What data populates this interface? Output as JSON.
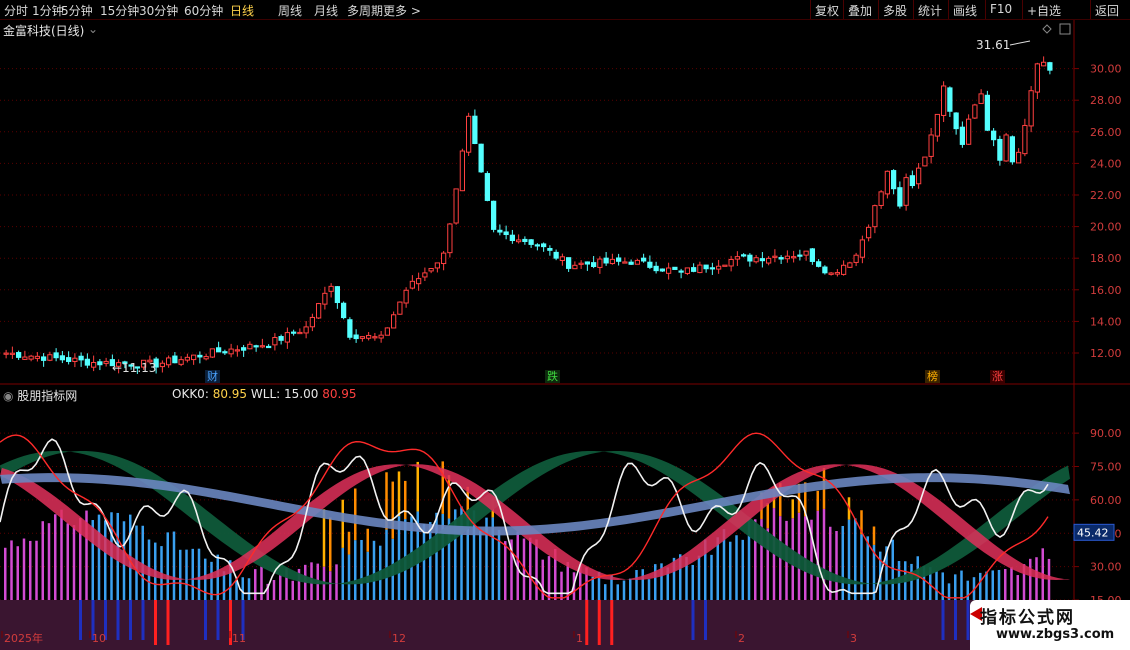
{
  "toolbar": {
    "left": [
      "分时",
      "1分钟",
      "5分钟",
      "15分钟",
      "30分钟",
      "60分钟",
      "日线",
      "周线",
      "月线",
      "多周期",
      "更多 >"
    ],
    "active": "日线",
    "right": [
      "复权",
      "叠加",
      "多股",
      "统计",
      "画线",
      "F10",
      "+自选",
      "返回"
    ]
  },
  "stock": {
    "title": "金富科技(日线)",
    "high_label": "31.61",
    "low_label": "11.13",
    "y_ticks": [
      "30.00",
      "28.00",
      "26.00",
      "24.00",
      "22.00",
      "20.00",
      "18.00",
      "16.00",
      "14.00",
      "12.00"
    ]
  },
  "markers": [
    {
      "text": "财",
      "color": "#4aa3ff",
      "bg": "#0a1f3a"
    },
    {
      "text": "跌",
      "color": "#3fdc3f",
      "bg": "#0d2a0d"
    },
    {
      "text": "榜",
      "color": "#ffb000",
      "bg": "#3a2400"
    },
    {
      "text": "涨",
      "color": "#ff4040",
      "bg": "#3a0000"
    }
  ],
  "indicator": {
    "name": "股朋指标网",
    "okk_label": "OKK0:",
    "okk_value": "80.95",
    "wll_label": "WLL:",
    "wll_value": "15.00",
    "extra_value": "80.95",
    "y_ticks": [
      "90.00",
      "75.00",
      "60.00",
      "45.00",
      "30.00",
      "15.00"
    ],
    "current_value": "45.42"
  },
  "time_axis": [
    "2025年",
    "10",
    "11",
    "12",
    "1",
    "2",
    "3"
  ],
  "watermark": {
    "title": "指标公式网",
    "url": "www.zbgs3.com"
  },
  "colors": {
    "up": "#ff4040",
    "down": "#54ffff",
    "grid": "#5a0000",
    "accent": "#ffd24a"
  }
}
